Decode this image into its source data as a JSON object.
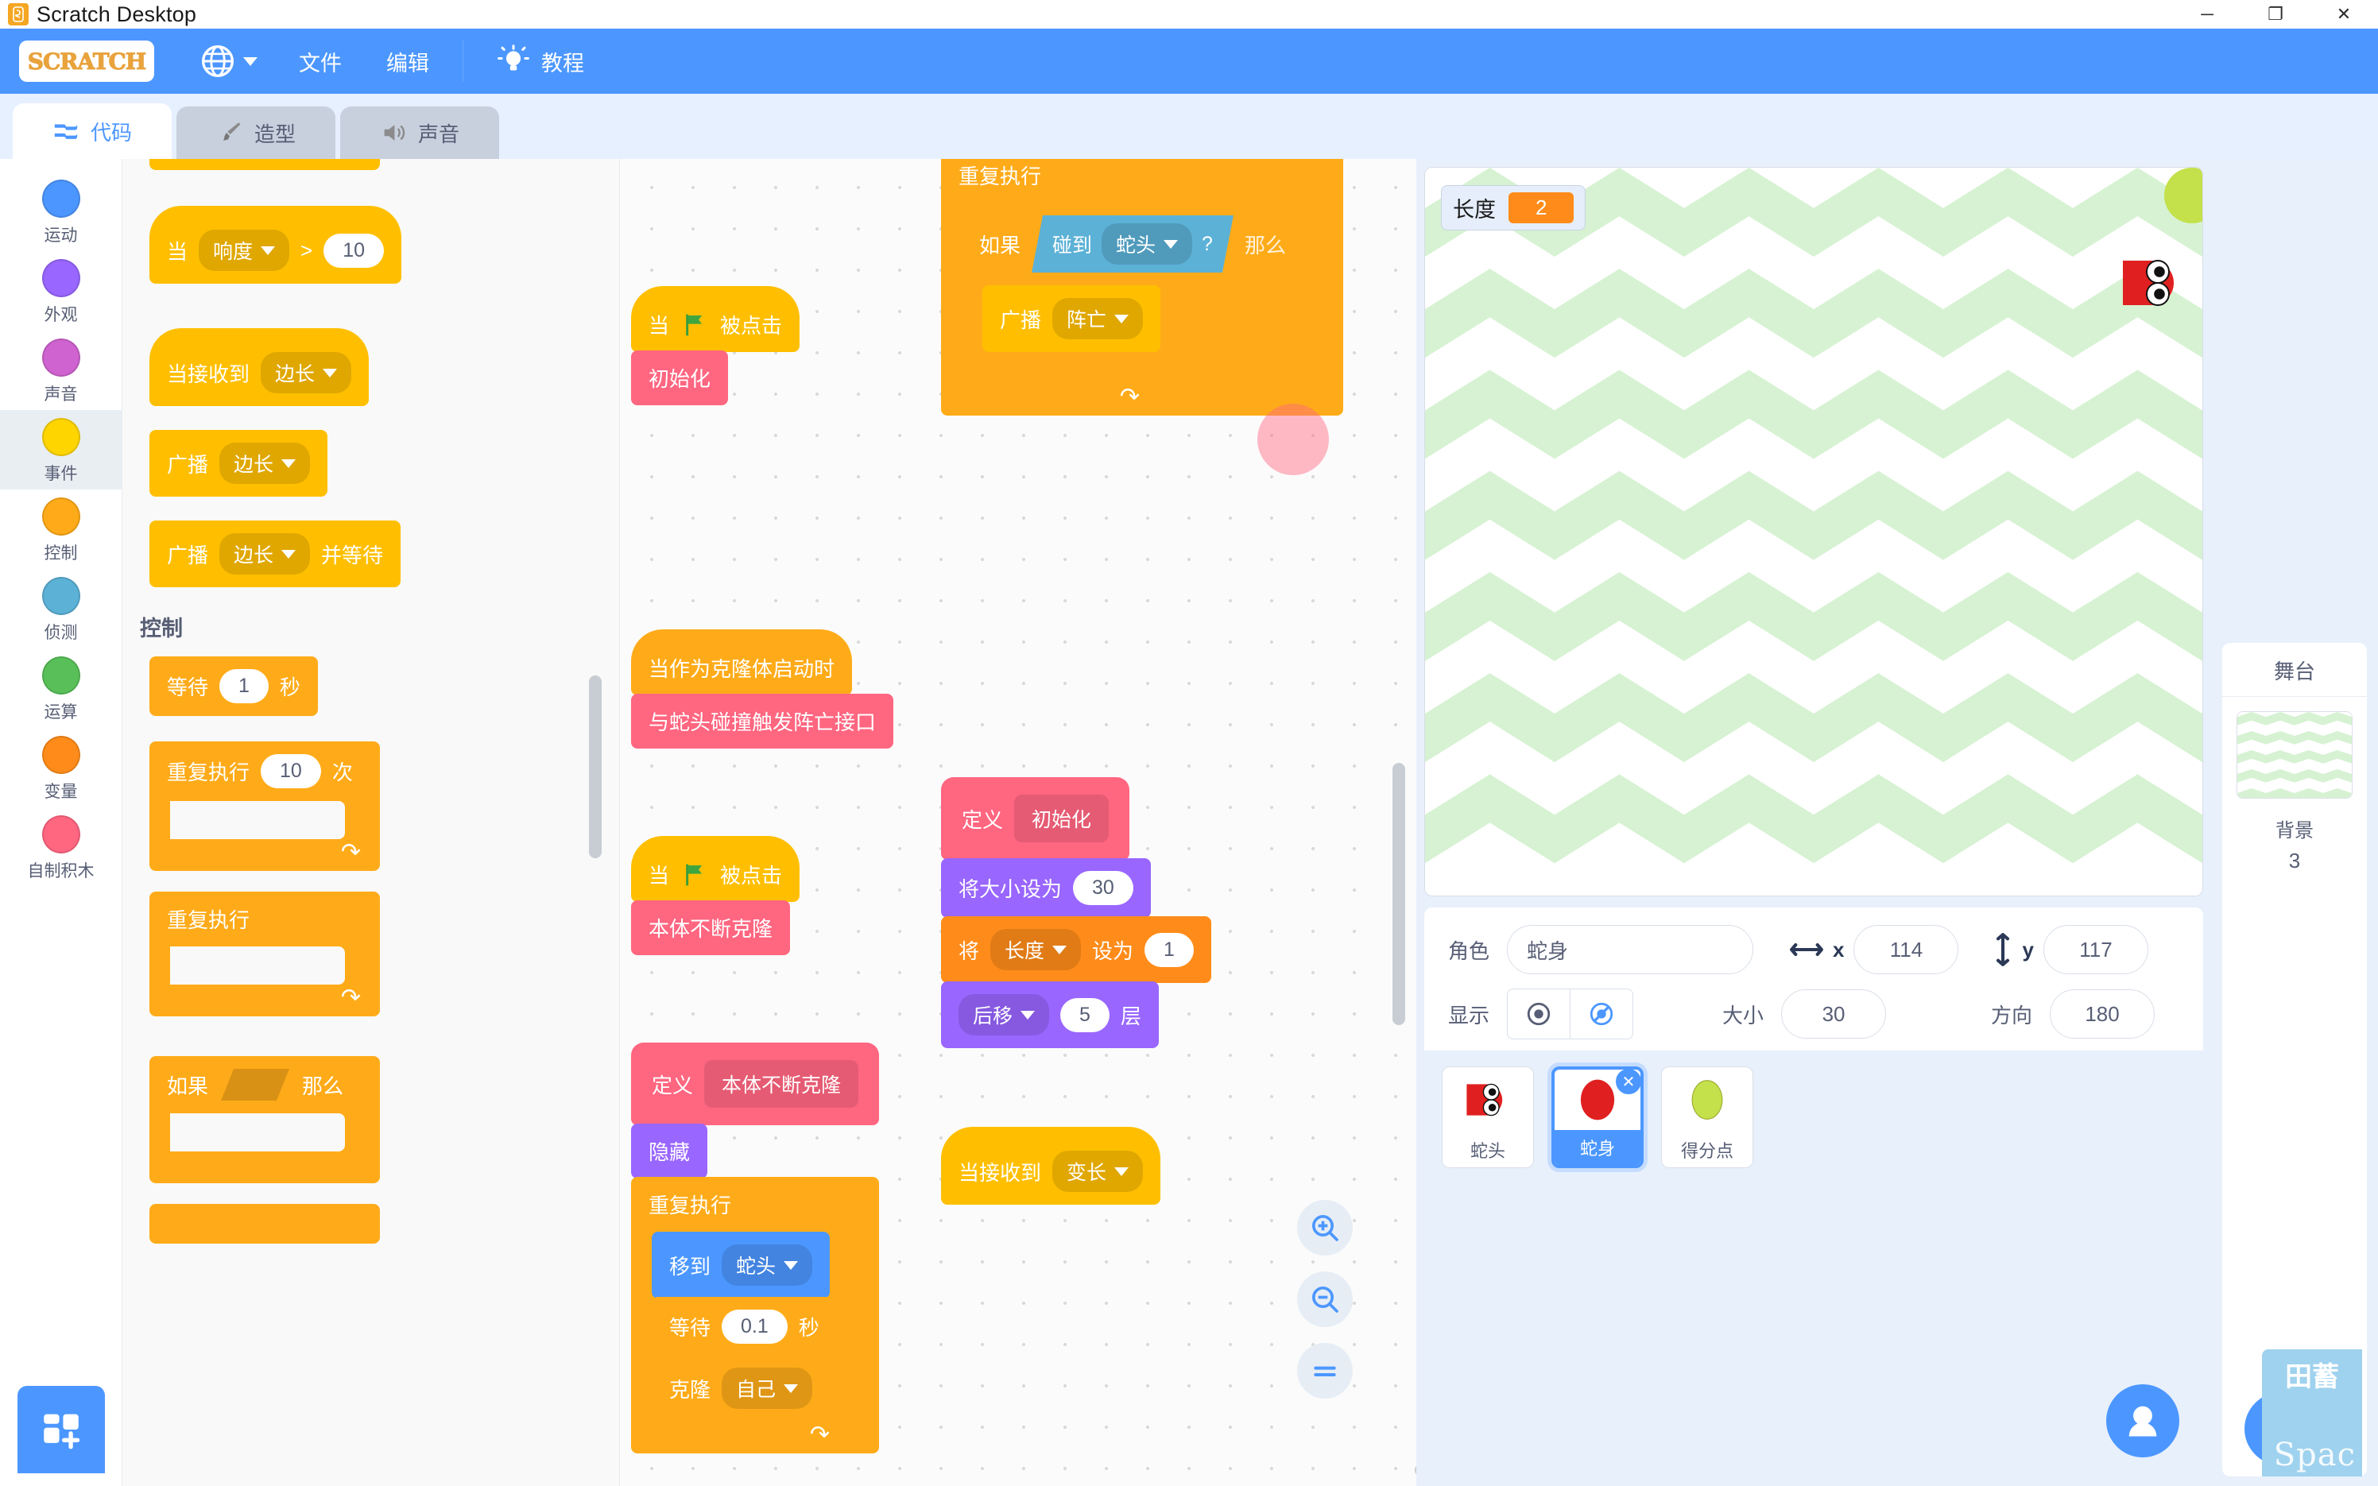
{
  "window": {
    "title": "Scratch Desktop",
    "app_icon": "scratch-app-icon",
    "minimize": "─",
    "maximize": "❐",
    "close": "✕"
  },
  "menubar": {
    "logo_text": "SCRATCH",
    "language_icon": "globe-icon",
    "items": [
      {
        "label": "文件"
      },
      {
        "label": "编辑"
      }
    ],
    "tutorial": {
      "label": "教程",
      "icon": "lightbulb-icon"
    }
  },
  "tabs": [
    {
      "label": "代码",
      "icon": "code-icon",
      "active": true
    },
    {
      "label": "造型",
      "icon": "paintbrush-icon",
      "active": false
    },
    {
      "label": "声音",
      "icon": "speaker-icon",
      "active": false
    }
  ],
  "stage_controls": {
    "green_flag": "green-flag-icon",
    "stop": "stop-icon",
    "small_stage": "small-stage-icon",
    "large_stage": "large-stage-icon",
    "fullscreen": "fullscreen-icon"
  },
  "categories": [
    {
      "label": "运动",
      "color": "#4c97ff",
      "active": false
    },
    {
      "label": "外观",
      "color": "#9966ff",
      "active": false
    },
    {
      "label": "声音",
      "color": "#cf63cf",
      "active": false
    },
    {
      "label": "事件",
      "color": "#ffd500",
      "active": true
    },
    {
      "label": "控制",
      "color": "#ffab19",
      "active": false
    },
    {
      "label": "侦测",
      "color": "#5cb1d6",
      "active": false
    },
    {
      "label": "运算",
      "color": "#59c059",
      "active": false
    },
    {
      "label": "变量",
      "color": "#ff8c1a",
      "active": false
    },
    {
      "label": "自制积木",
      "color": "#ff6680",
      "active": false
    }
  ],
  "add_extension_label": "add-extension-button",
  "palette": {
    "section_control_header": "控制",
    "blocks": {
      "when_loudness": {
        "when": "当",
        "menu": "响度",
        "op": ">",
        "value": "10"
      },
      "when_receive": {
        "label": "当接收到",
        "menu": "边长"
      },
      "broadcast": {
        "label": "广播",
        "menu": "边长"
      },
      "broadcast_wait": {
        "label": "广播",
        "menu": "边长",
        "suffix": "并等待"
      },
      "wait_secs": {
        "label": "等待",
        "value": "1",
        "unit": "秒"
      },
      "repeat_n": {
        "label": "重复执行",
        "value": "10",
        "unit": "次"
      },
      "forever": {
        "label": "重复执行"
      },
      "if_then": {
        "if": "如果",
        "then": "那么"
      }
    }
  },
  "workspace": {
    "scripts": [
      {
        "id": "script-flag-init",
        "blocks": [
          {
            "type": "hat",
            "cat": "event",
            "text": "当",
            "flag": true,
            "suffix": "被点击"
          },
          {
            "type": "stack",
            "cat": "custom",
            "text": "初始化"
          }
        ]
      },
      {
        "id": "script-clone-start",
        "blocks": [
          {
            "type": "hat",
            "cat": "control",
            "text": "当作为克隆体启动时"
          },
          {
            "type": "stack",
            "cat": "custom",
            "text": "与蛇头碰撞触发阵亡接口"
          }
        ]
      },
      {
        "id": "script-flag-clone",
        "blocks": [
          {
            "type": "hat",
            "cat": "event",
            "text": "当",
            "flag": true,
            "suffix": "被点击"
          },
          {
            "type": "stack",
            "cat": "custom",
            "text": "本体不断克隆"
          }
        ]
      },
      {
        "id": "script-define-clone",
        "define_word": "定义",
        "define_name": "本体不断克隆",
        "blocks": [
          {
            "type": "stack",
            "cat": "looks",
            "text": "隐藏"
          },
          {
            "type": "wrap",
            "cat": "control",
            "text": "重复执行",
            "children": [
              {
                "type": "stack",
                "cat": "motion",
                "text": "移到",
                "menu": "蛇头"
              },
              {
                "type": "stack",
                "cat": "control",
                "text": "等待",
                "value": "0.1",
                "unit": "秒"
              },
              {
                "type": "stack",
                "cat": "control",
                "text": "克隆",
                "menu": "自己"
              }
            ]
          }
        ]
      },
      {
        "id": "script-forever-if",
        "blocks": [
          {
            "type": "wrap",
            "cat": "control",
            "text": "重复执行",
            "children": [
              {
                "type": "ifwrap",
                "cat": "control",
                "if": "如果",
                "then": "那么",
                "cond": {
                  "text": "碰到",
                  "menu": "蛇头",
                  "q": "?"
                },
                "children": [
                  {
                    "type": "stack",
                    "cat": "event",
                    "text": "广播",
                    "menu": "阵亡"
                  }
                ]
              }
            ]
          }
        ]
      },
      {
        "id": "script-define-init",
        "define_word": "定义",
        "define_name": "初始化",
        "blocks": [
          {
            "type": "stack",
            "cat": "looks",
            "text": "将大小设为",
            "value": "30"
          },
          {
            "type": "stack",
            "cat": "vars",
            "text": "将",
            "menu": "长度",
            "mid": "设为",
            "value": "1"
          },
          {
            "type": "stack",
            "cat": "looks",
            "menu": "后移",
            "value": "5",
            "unit": "层"
          }
        ]
      },
      {
        "id": "script-when-receive-grow",
        "blocks": [
          {
            "type": "hat",
            "cat": "event",
            "text": "当接收到",
            "menu": "变长"
          }
        ]
      }
    ],
    "zoom_in": "+",
    "zoom_out": "−",
    "zoom_reset": "="
  },
  "stage": {
    "variable_monitor": {
      "name": "长度",
      "value": "2"
    },
    "sprite_on_stage": "snake-head-sprite"
  },
  "sprite_info": {
    "name_label": "角色",
    "name_value": "蛇身",
    "x_label": "x",
    "x_value": "114",
    "y_label": "y",
    "y_value": "117",
    "show_label": "显示",
    "size_label": "大小",
    "size_value": "30",
    "direction_label": "方向",
    "direction_value": "180"
  },
  "sprites": [
    {
      "name": "蛇头",
      "selected": false,
      "thumb": "snake-head-thumb"
    },
    {
      "name": "蛇身",
      "selected": true,
      "thumb": "snake-body-thumb"
    },
    {
      "name": "得分点",
      "selected": false,
      "thumb": "score-point-thumb"
    }
  ],
  "stage_panel": {
    "title": "舞台",
    "backdrop_label": "背景",
    "backdrop_count": "3",
    "add_backdrop": "add-backdrop-button"
  },
  "add_sprite_button": "add-sprite-button",
  "watermark": "Spac",
  "colors": {
    "brand_blue": "#4c97ff",
    "event_yellow": "#ffbf00",
    "control_orange": "#ffab19",
    "motion_blue": "#4c97ff",
    "looks_purple": "#9966ff",
    "sound_magenta": "#cf63cf",
    "sensing_cyan": "#5cb1d6",
    "operators_green": "#59c059",
    "variables_orange": "#ff8c1a",
    "custom_pink": "#ff6680"
  }
}
